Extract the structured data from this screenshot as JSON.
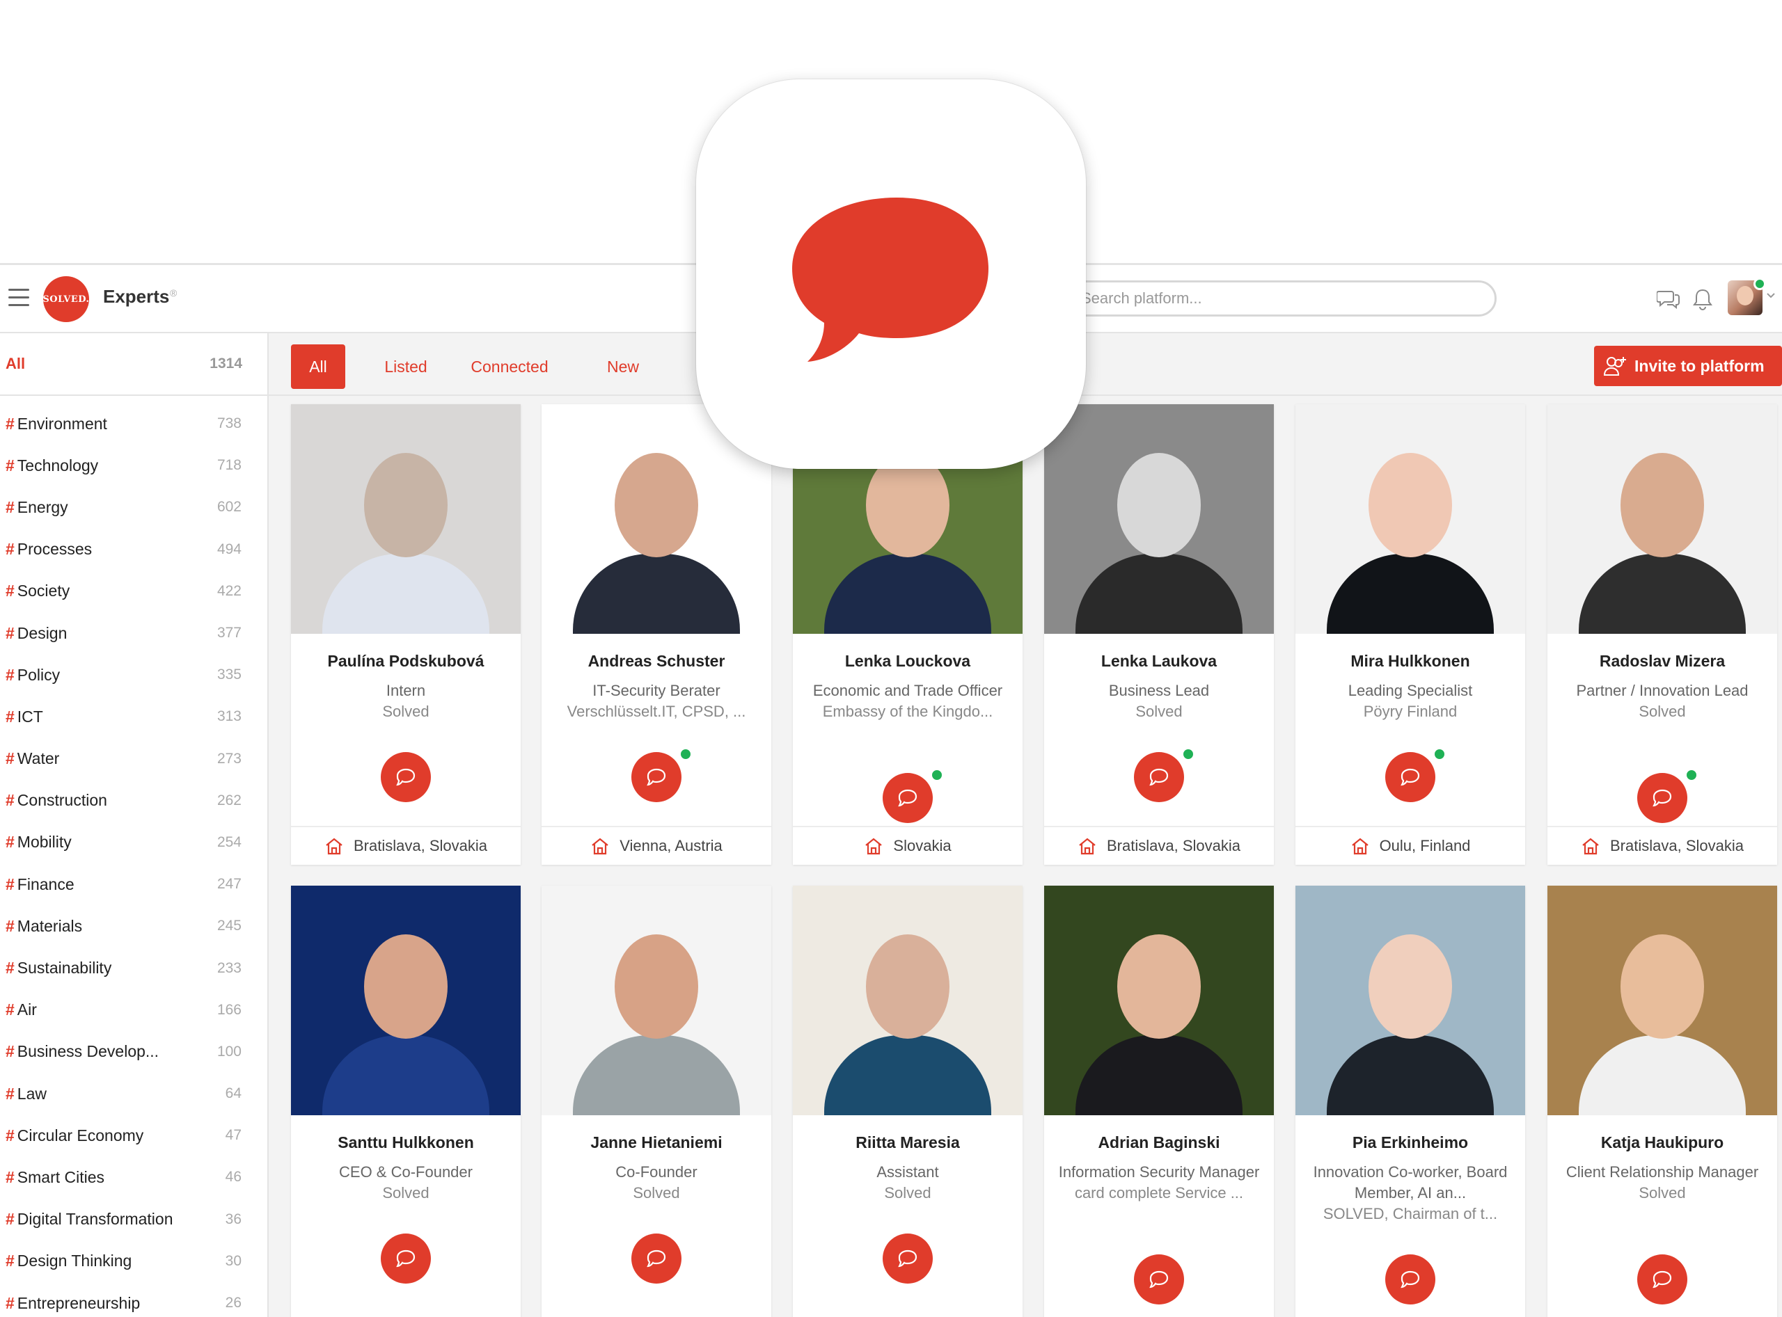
{
  "header": {
    "logo_text": "SOLVED.",
    "title": "Experts",
    "title_mark": "®",
    "search_placeholder": "Search platform...",
    "icons": [
      "menu-icon",
      "chat-icon",
      "bell-icon",
      "chevron-down-icon"
    ]
  },
  "sidebar": {
    "all": {
      "label": "All",
      "count": "1314"
    },
    "tags": [
      {
        "name": "Environment",
        "count": "738"
      },
      {
        "name": "Technology",
        "count": "718"
      },
      {
        "name": "Energy",
        "count": "602"
      },
      {
        "name": "Processes",
        "count": "494"
      },
      {
        "name": "Society",
        "count": "422"
      },
      {
        "name": "Design",
        "count": "377"
      },
      {
        "name": "Policy",
        "count": "335"
      },
      {
        "name": "ICT",
        "count": "313"
      },
      {
        "name": "Water",
        "count": "273"
      },
      {
        "name": "Construction",
        "count": "262"
      },
      {
        "name": "Mobility",
        "count": "254"
      },
      {
        "name": "Finance",
        "count": "247"
      },
      {
        "name": "Materials",
        "count": "245"
      },
      {
        "name": "Sustainability",
        "count": "233"
      },
      {
        "name": "Air",
        "count": "166"
      },
      {
        "name": "Business Develop...",
        "count": "100"
      },
      {
        "name": "Law",
        "count": "64"
      },
      {
        "name": "Circular Economy",
        "count": "47"
      },
      {
        "name": "Smart Cities",
        "count": "46"
      },
      {
        "name": "Digital Transformation",
        "count": "36"
      },
      {
        "name": "Design Thinking",
        "count": "30"
      },
      {
        "name": "Entrepreneurship",
        "count": "26"
      }
    ]
  },
  "tabs": [
    {
      "label": "All",
      "active": true
    },
    {
      "label": "Listed",
      "active": false
    },
    {
      "label": "Connected",
      "active": false
    },
    {
      "label": "New",
      "active": false
    }
  ],
  "invite_label": "Invite to platform",
  "experts": [
    {
      "name": "Paulína Podskubová",
      "title": "Intern",
      "org": "Solved",
      "location": "Bratislava, Slovakia",
      "online": false
    },
    {
      "name": "Andreas Schuster",
      "title": "IT-Security Berater",
      "org": "Verschlüsselt.IT, CPSD, ...",
      "location": "Vienna, Austria",
      "online": true
    },
    {
      "name": "Lenka Louckova",
      "title": "Economic and Trade Officer",
      "org": "Embassy of the Kingdo...",
      "location": "Slovakia",
      "online": true
    },
    {
      "name": "Lenka Laukova",
      "title": "Business Lead",
      "org": "Solved",
      "location": "Bratislava, Slovakia",
      "online": true
    },
    {
      "name": "Mira Hulkkonen",
      "title": "Leading Specialist",
      "org": "Pöyry Finland",
      "location": "Oulu, Finland",
      "online": true
    },
    {
      "name": "Radoslav Mizera",
      "title": "Partner / Innovation Lead",
      "org": "Solved",
      "location": "Bratislava, Slovakia",
      "online": true
    },
    {
      "name": "Santtu Hulkkonen",
      "title": "CEO & Co-Founder",
      "org": "Solved",
      "location": "",
      "online": false
    },
    {
      "name": "Janne Hietaniemi",
      "title": "Co-Founder",
      "org": "Solved",
      "location": "",
      "online": false
    },
    {
      "name": "Riitta Maresia",
      "title": "Assistant",
      "org": "Solved",
      "location": "",
      "online": false
    },
    {
      "name": "Adrian Baginski",
      "title": "Information Security Manager",
      "org": "card complete Service ...",
      "location": "",
      "online": false
    },
    {
      "name": "Pia Erkinheimo",
      "title": "Innovation Co-worker, Board Member, AI an...",
      "org": "SOLVED, Chairman of t...",
      "location": "",
      "online": false
    },
    {
      "name": "Katja Haukipuro",
      "title": "Client Relationship Manager",
      "org": "Solved",
      "location": "",
      "online": false
    }
  ],
  "overlay_icon": "speech-bubble-app-icon",
  "colors": {
    "accent": "#e03c2b",
    "online": "#1fb155"
  }
}
